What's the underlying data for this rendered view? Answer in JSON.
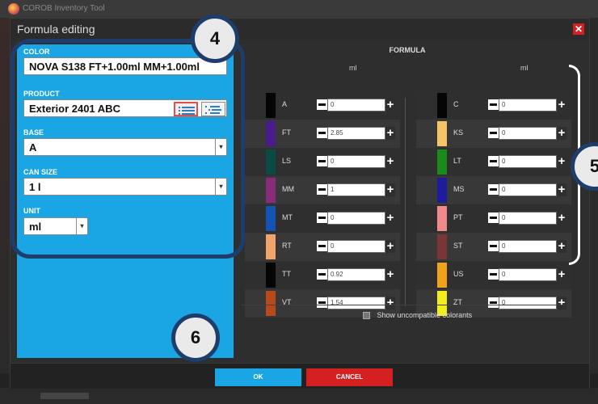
{
  "background_app": {
    "title": "COROB Inventory Tool"
  },
  "dialog": {
    "title": "Formula editing",
    "close_label": "✕"
  },
  "left_panel": {
    "color_label": "COLOR",
    "color_value": "NOVA S138 FT+1.00ml MM+1.00ml",
    "product_label": "PRODUCT",
    "product_value": "Exterior 2401 ABC",
    "base_label": "BASE",
    "base_value": "A",
    "can_size_label": "CAN SIZE",
    "can_size_value": "1 l",
    "unit_label": "UNIT",
    "unit_value": "ml",
    "dropdown_glyph": "▾"
  },
  "formula": {
    "title": "FORMULA",
    "unit_header_left": "ml",
    "unit_header_right": "ml",
    "left_column": [
      {
        "code": "A",
        "value": "0",
        "color": "#050505"
      },
      {
        "code": "FT",
        "value": "2.85",
        "color": "#4b1a8c"
      },
      {
        "code": "LS",
        "value": "0",
        "color": "#0c4a45"
      },
      {
        "code": "MM",
        "value": "1",
        "color": "#8a2b78"
      },
      {
        "code": "MT",
        "value": "0",
        "color": "#1452b8"
      },
      {
        "code": "RT",
        "value": "0",
        "color": "#f3a46a"
      },
      {
        "code": "TT",
        "value": "0.92",
        "color": "#050505"
      },
      {
        "code": "VT",
        "value": "1.54",
        "color": "#b8491b"
      }
    ],
    "right_column": [
      {
        "code": "C",
        "value": "0",
        "color": "#050505"
      },
      {
        "code": "KS",
        "value": "0",
        "color": "#f4c468"
      },
      {
        "code": "LT",
        "value": "0",
        "color": "#1a8a1a"
      },
      {
        "code": "MS",
        "value": "0",
        "color": "#1c1c9c"
      },
      {
        "code": "PT",
        "value": "0",
        "color": "#f08a8a"
      },
      {
        "code": "ST",
        "value": "0",
        "color": "#7a3535"
      },
      {
        "code": "US",
        "value": "0",
        "color": "#efa21a"
      },
      {
        "code": "ZT",
        "value": "0",
        "color": "#f2ee1a"
      }
    ],
    "minus_glyph": "",
    "plus_glyph": "+",
    "show_incompatible_label": "Show uncompatible colorants"
  },
  "buttons": {
    "ok_label": "OK",
    "cancel_label": "CANCEL"
  },
  "callouts": {
    "step_4": "4",
    "step_5": "5",
    "step_6": "6"
  },
  "colors": {
    "accent_blue": "#1aa6e4",
    "cancel_red": "#d42020",
    "callout_border": "#1f3d6b"
  }
}
